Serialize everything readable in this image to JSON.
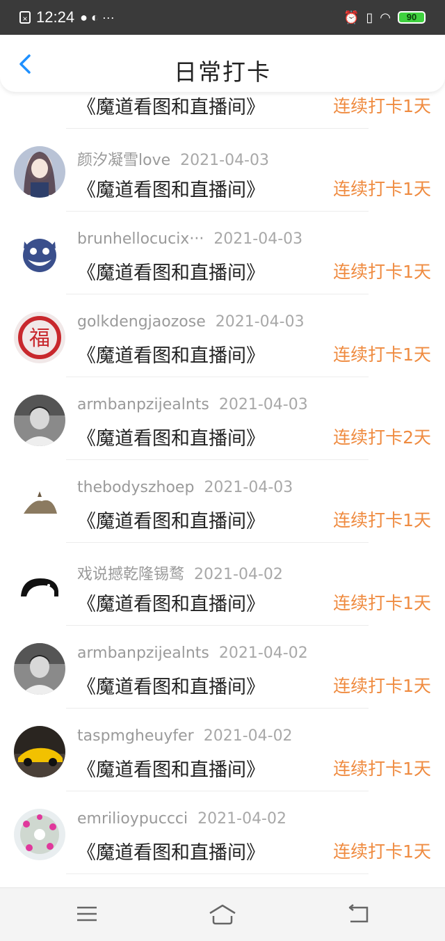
{
  "status_bar": {
    "time": "12:24",
    "extra": "···",
    "battery": "90"
  },
  "header": {
    "title": "日常打卡"
  },
  "colors": {
    "streak": "#ef8b40",
    "accent_back": "#1e90ff"
  },
  "items": [
    {
      "name": "",
      "date": "",
      "book": "《魔道看图和直播间》",
      "streak": "连续打卡1天",
      "avatar": "none"
    },
    {
      "name": "颜汐凝雪love",
      "date": "2021-04-03",
      "book": "《魔道看图和直播间》",
      "streak": "连续打卡1天",
      "avatar": "anime-girl"
    },
    {
      "name": "brunhellocucix···",
      "date": "2021-04-03",
      "book": "《魔道看图和直播间》",
      "streak": "连续打卡1天",
      "avatar": "blue-monster"
    },
    {
      "name": "golkdengjaozose",
      "date": "2021-04-03",
      "book": "《魔道看图和直播间》",
      "streak": "连续打卡1天",
      "avatar": "fu-character"
    },
    {
      "name": "armbanpzijealnts",
      "date": "2021-04-03",
      "book": "《魔道看图和直播间》",
      "streak": "连续打卡2天",
      "avatar": "bw-portrait"
    },
    {
      "name": "thebodyszhoep",
      "date": "2021-04-03",
      "book": "《魔道看图和直播间》",
      "streak": "连续打卡1天",
      "avatar": "cat"
    },
    {
      "name": "戏说撼乾隆锡鹜",
      "date": "2021-04-02",
      "book": "《魔道看图和直播间》",
      "streak": "连续打卡1天",
      "avatar": "elephant-logo"
    },
    {
      "name": "armbanpzijealnts",
      "date": "2021-04-02",
      "book": "《魔道看图和直播间》",
      "streak": "连续打卡1天",
      "avatar": "bw-portrait"
    },
    {
      "name": "taspmgheuyfer",
      "date": "2021-04-02",
      "book": "《魔道看图和直播间》",
      "streak": "连续打卡1天",
      "avatar": "yellow-car"
    },
    {
      "name": "emrilioypuccci",
      "date": "2021-04-02",
      "book": "《魔道看图和直播间》",
      "streak": "连续打卡1天",
      "avatar": "flower"
    }
  ],
  "nav": {
    "icons": [
      "menu-icon",
      "home-icon",
      "back-icon"
    ]
  }
}
